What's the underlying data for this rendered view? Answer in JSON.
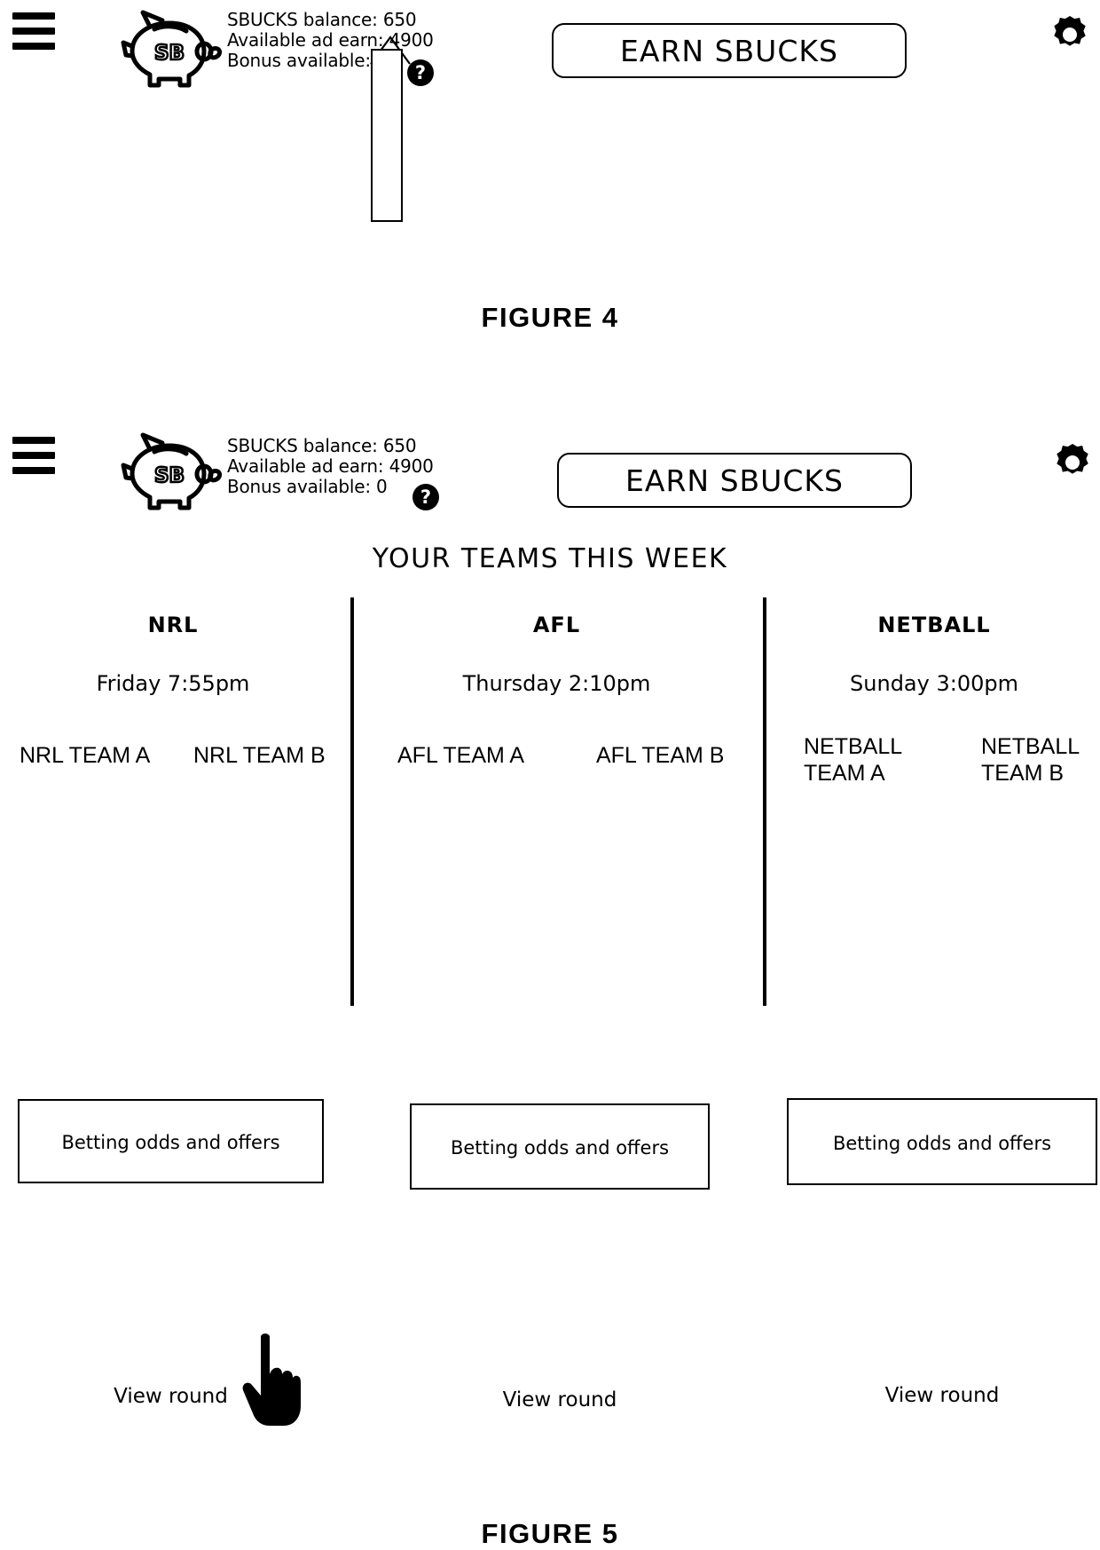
{
  "figures": [
    {
      "id": "figure-4",
      "caption": "FIGURE 4"
    },
    {
      "id": "figure-5",
      "caption": "FIGURE 5"
    }
  ],
  "header": {
    "menu_icon": "hamburger-menu-icon",
    "piggy_icon": "piggy-bank-icon",
    "piggy_label": "SB",
    "balance_label": "SBUCKS balance: 650",
    "ad_earn_label": "Available ad earn: 4900",
    "bonus_label": "Bonus available: 0",
    "help_icon": "help-question-icon",
    "help_glyph": "?",
    "earn_button_label": "EARN SBUCKS",
    "settings_icon": "gear-icon"
  },
  "figure4": {
    "callout_panel_name": "empty-callout-panel"
  },
  "figure5": {
    "section_title": "YOUR TEAMS THIS WEEK",
    "columns": [
      {
        "sport": "NRL",
        "time": "Friday 7:55pm",
        "team_a": "NRL TEAM A",
        "team_b": "NRL TEAM B",
        "odds_label": "Betting odds and offers",
        "view_round_label": "View round"
      },
      {
        "sport": "AFL",
        "time": "Thursday 2:10pm",
        "team_a": "AFL TEAM A",
        "team_b": "AFL TEAM B",
        "odds_label": "Betting odds and offers",
        "view_round_label": "View round"
      },
      {
        "sport": "NETBALL",
        "time": "Sunday 3:00pm",
        "team_a": "NETBALL TEAM A",
        "team_b": "NETBALL TEAM B",
        "odds_label": "Betting odds and offers",
        "view_round_label": "View round"
      }
    ],
    "cursor": "pointing-hand-cursor"
  },
  "colors": {
    "ink": "#000000",
    "paper": "#ffffff"
  }
}
